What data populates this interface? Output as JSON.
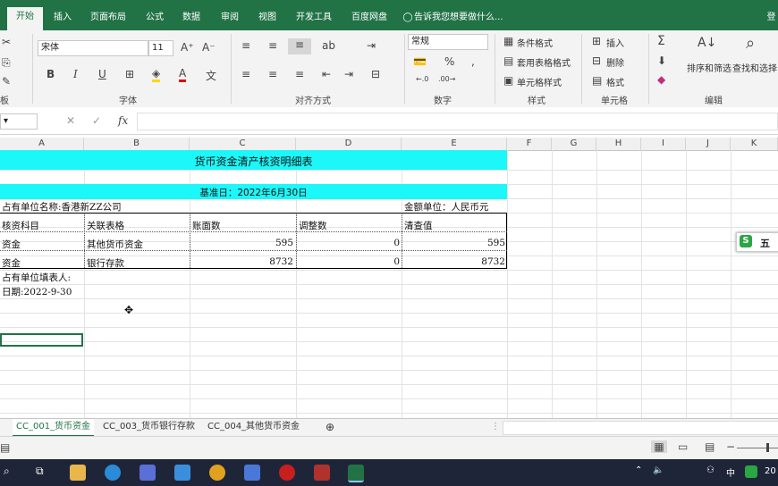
{
  "ribbon": {
    "tabs": [
      "开始",
      "插入",
      "页面布局",
      "公式",
      "数据",
      "审阅",
      "视图",
      "开发工具",
      "百度网盘"
    ],
    "tell_me": "告诉我您想要做什么...",
    "login": "登",
    "font_name": "宋体",
    "font_size": "11",
    "number_format": "常规",
    "groups": {
      "font": "字体",
      "alignment": "对齐方式",
      "number": "数字",
      "styles": "样式",
      "cells": "单元格",
      "editing": "编辑",
      "clipboard": "板"
    },
    "styles": {
      "conditional": "条件格式",
      "table": "套用表格格式",
      "cell_styles": "单元格样式"
    },
    "cells": {
      "insert": "插入",
      "delete": "删除",
      "format": "格式"
    },
    "editing": {
      "sort": "排序和筛选",
      "find": "查找和选择"
    }
  },
  "formula_bar": {
    "fx": "fx",
    "value": ""
  },
  "columns": [
    "A",
    "B",
    "C",
    "D",
    "E",
    "F",
    "G",
    "H",
    "I",
    "J",
    "K"
  ],
  "sheet": {
    "title": "货币资金清产核资明细表",
    "base_date": "基准日：2022年6月30日",
    "unit_name": "占有单位名称:香港新ZZ公司",
    "currency_unit": "金额单位：人民币元",
    "headers": [
      "核资科目",
      "关联表格",
      "账面数",
      "调整数",
      "清查值"
    ],
    "rows": [
      [
        "资金",
        "其他货币资金",
        "595",
        "0",
        "595"
      ],
      [
        "资金",
        "银行存款",
        "8732",
        "0",
        "8732"
      ]
    ],
    "filler": "占有单位填表人:",
    "date": "日期:2022-9-30"
  },
  "sheet_tabs": [
    "CC_001_货币资金",
    "CC_003_货币银行存款",
    "CC_004_其他货币资金"
  ],
  "side_popup": "五",
  "taskbar": {
    "tray_ime": "中",
    "tray_time": "20"
  },
  "colors": {
    "ribbon_green": "#217346",
    "header_cyan": "#1cf7f9"
  }
}
